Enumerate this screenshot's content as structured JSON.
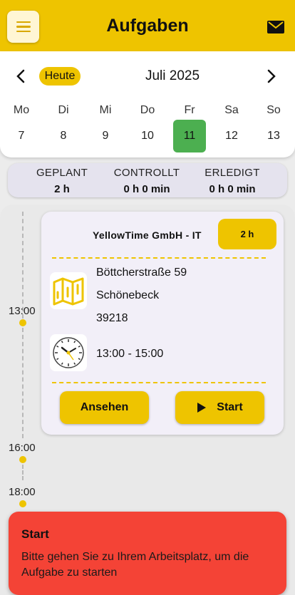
{
  "header": {
    "title": "Aufgaben",
    "menu_icon": "menu-icon",
    "mail_icon": "mail-icon"
  },
  "calendar": {
    "today_label": "Heute",
    "month_label": "Juli 2025",
    "weekdays": [
      "Mo",
      "Di",
      "Mi",
      "Do",
      "Fr",
      "Sa",
      "So"
    ],
    "days": [
      "7",
      "8",
      "9",
      "10",
      "11",
      "12",
      "13"
    ],
    "selected_day": "11"
  },
  "summary": {
    "planned_label": "GEPLANT",
    "planned_value": "2 h",
    "controlled_label": "CONTROLLT",
    "controlled_value": "0 h 0 min",
    "done_label": "ERLEDIGT",
    "done_value": "0 h 0 min"
  },
  "timeline": {
    "times": [
      "13:00",
      "16:00",
      "18:00"
    ]
  },
  "task": {
    "company": "YellowTime GmbH - IT",
    "duration": "2 h",
    "street": "Böttcherstraße  59",
    "city": "Schönebeck",
    "zip": "39218",
    "time_range": "13:00 - 15:00",
    "view_label": "Ansehen",
    "start_label": "Start"
  },
  "toast": {
    "title": "Start",
    "message": "Bitte gehen Sie zu Ihrem Arbeitsplatz, um die Aufgabe zu starten"
  },
  "colors": {
    "accent": "#eec400",
    "selected_day": "#4caf50",
    "toast": "#f44336"
  }
}
